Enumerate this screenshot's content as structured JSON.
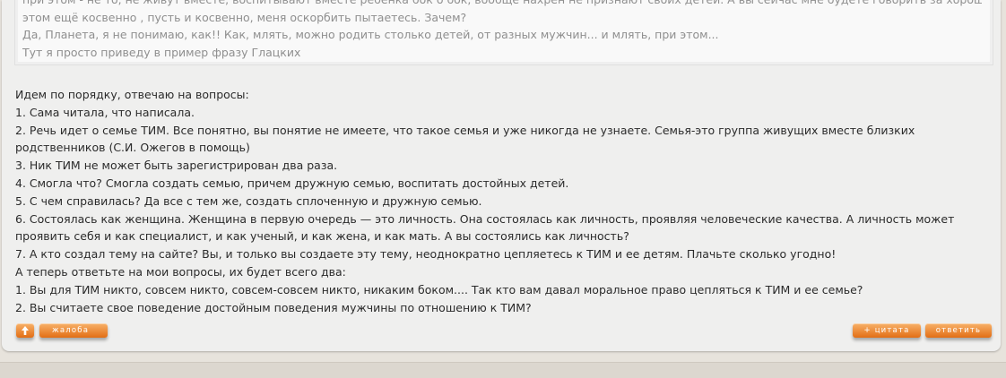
{
  "quote": {
    "lines": [
      "при этом - не то, не живут вместе, воспитывают вместе ребенка бок о бок, вообще нахрен не признают своих детей. А вы сейчас мне будете говорить за хорошего папу, и при",
      "этом ещё косвенно , пусть и косвенно, меня оскорбить пытаетесь. Зачем?",
      "Да, Планета, я не понимаю, как!! Как, млять, можно родить столько детей, от разных мужчин... и млять, при этом...",
      "Тут я просто приведу в пример фразу Глацких"
    ]
  },
  "post": {
    "lines": [
      "Идем по порядку, отвечаю на вопросы:",
      "1. Сама читала, что написала.",
      "2. Речь идет о семье ТИМ. Все понятно, вы понятие не имеете, что такое семья и уже никогда не узнаете. Семья-это группа живущих вместе близких родственников (С.И. Ожегов в помощь)",
      "3. Ник ТИМ не может быть зарегистрирован два раза.",
      "4. Смогла что? Смогла создать семью, причем дружную семью, воспитать достойных детей.",
      "5. С чем справилась? Да все с тем же, создать сплоченную и дружную семью.",
      "6. Состоялась как женщина. Женщина в первую очередь — это личность. Она состоялась как личность, проявляя человеческие качества. А личность может проявить себя и как специалист, и как ученый, и как жена, и как мать. А вы состоялись как личность?",
      "7. А кто создал тему на сайте? Вы, и только вы создаете эту тему, неоднократно цепляетесь к ТИМ и ее детям. Плачьте сколько угодно!",
      "А теперь ответьте на мои вопросы, их будет всего два:",
      "1. Вы для ТИМ никто, совсем никто, совсем-совсем никто, никаким боком.... Так кто вам давал моральное право цепляться к ТИМ и ее семье?",
      "2. Вы считаете свое поведение достойным поведения мужчины по отношению к ТИМ?"
    ]
  },
  "buttons": {
    "up_icon": "arrow-up-icon",
    "complaint": "жалоба",
    "quote": "+ цитата",
    "reply": "ответить"
  },
  "colors": {
    "button_orange": "#e8781f",
    "text": "#2b2b2b",
    "quote_text": "#8f8f8f"
  }
}
